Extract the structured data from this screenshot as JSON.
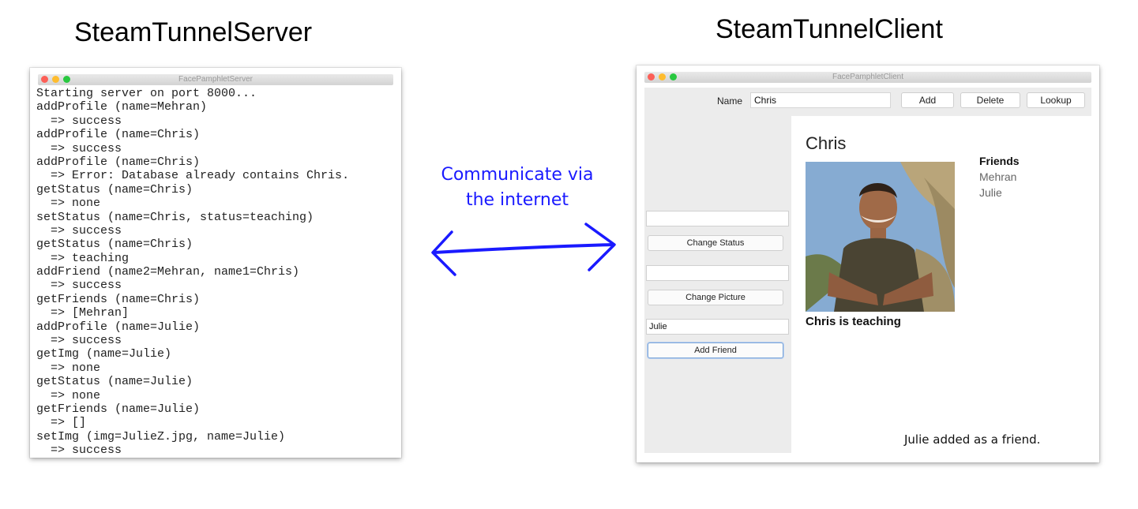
{
  "server": {
    "heading": "SteamTunnelServer",
    "window_title": "FacePamphletServer",
    "console_lines": [
      "Starting server on port 8000...",
      "addProfile (name=Mehran)",
      "  => success",
      "addProfile (name=Chris)",
      "  => success",
      "addProfile (name=Chris)",
      "  => Error: Database already contains Chris.",
      "getStatus (name=Chris)",
      "  => none",
      "setStatus (name=Chris, status=teaching)",
      "  => success",
      "getStatus (name=Chris)",
      "  => teaching",
      "addFriend (name2=Mehran, name1=Chris)",
      "  => success",
      "getFriends (name=Chris)",
      "  => [Mehran]",
      "addProfile (name=Julie)",
      "  => success",
      "getImg (name=Julie)",
      "  => none",
      "getStatus (name=Julie)",
      "  => none",
      "getFriends (name=Julie)",
      "  => []",
      "setImg (img=JulieZ.jpg, name=Julie)",
      "  => success"
    ]
  },
  "arrow": {
    "label_line1": "Communicate via",
    "label_line2": "the internet",
    "color": "#1a1aff"
  },
  "client": {
    "heading": "SteamTunnelClient",
    "window_title": "FacePamphletClient",
    "toolbar": {
      "name_label": "Name",
      "name_value": "Chris",
      "add_label": "Add",
      "delete_label": "Delete",
      "lookup_label": "Lookup"
    },
    "sidebar": {
      "status_input_value": "",
      "change_status_label": "Change Status",
      "picture_input_value": "",
      "change_picture_label": "Change Picture",
      "friend_input_value": "Julie",
      "add_friend_label": "Add Friend"
    },
    "profile": {
      "name": "Chris",
      "status": "Chris is teaching",
      "friends_heading": "Friends",
      "friends": [
        "Mehran",
        "Julie"
      ]
    },
    "message": "Julie added as a friend."
  }
}
